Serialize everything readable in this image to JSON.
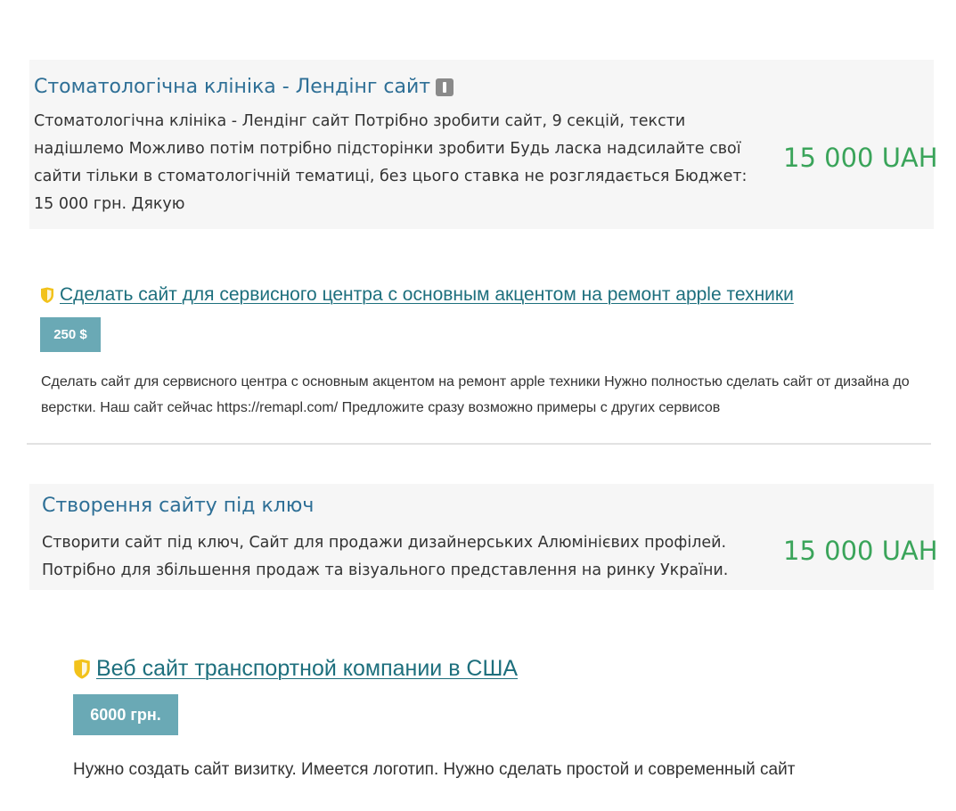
{
  "listings": [
    {
      "title": "Стоматологічна клініка - Лендінг сайт",
      "description": "Стоматологічна клініка - Лендінг сайт Потрібно зробити сайт, 9 секцій, тексти надішлемо Можливо потім потрібно підсторінки зробити Будь ласка надсилайте свої сайти тільки в стоматологічній тематиці, без цього ставка не розглядається Бюджет: 15 000 грн. Дякую",
      "price": "15 000 UAH",
      "icon": "info-icon"
    },
    {
      "title": "Сделать сайт для сервисного центра с основным акцентом на ремонт apple техники",
      "budget": "250 $",
      "description": "Сделать сайт для сервисного центра с основным акцентом на ремонт apple техники Нужно полностью сделать сайт от дизайна до верстки. Наш сайт сейчас https://remapl.com/ Предложите сразу возможно примеры с других сервисов",
      "icon": "shield-icon"
    },
    {
      "title": "Створення сайту під ключ",
      "description": "Створити сайт під ключ, Сайт для продажи дизайнерських Алюмінієвих профілей. Потрібно для збільшення продаж та візуального представлення на ринку України.",
      "price": "15 000 UAH"
    },
    {
      "title": "Веб сайт транспортной компании в США",
      "budget": "6000 грн.",
      "description": "Нужно создать сайт визитку. Имеется логотип. Нужно сделать простой и современный сайт",
      "icon": "shield-icon"
    }
  ],
  "colors": {
    "card_background": "#f6f6f6",
    "card_title": "#2e6f96",
    "price": "#3aa45a",
    "link": "#1d6f7d",
    "badge": "#6aa9b5",
    "shield": "#f2c21b"
  }
}
